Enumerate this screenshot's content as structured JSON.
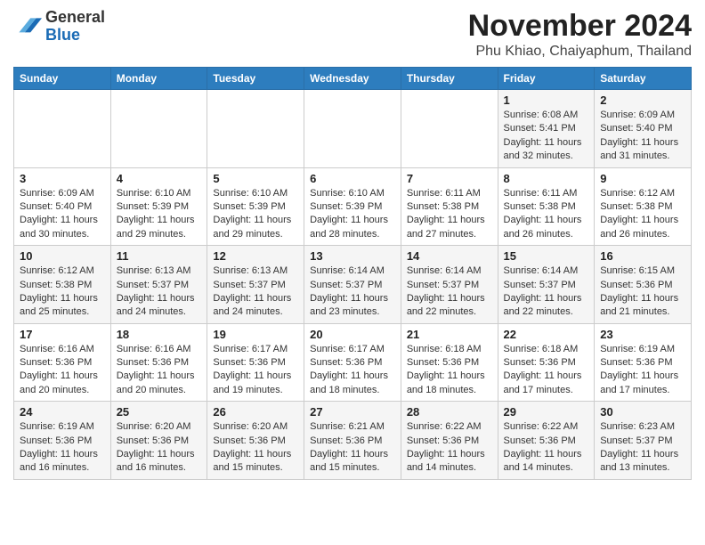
{
  "header": {
    "logo_line1": "General",
    "logo_line2": "Blue",
    "month_title": "November 2024",
    "location": "Phu Khiao, Chaiyaphum, Thailand"
  },
  "days_of_week": [
    "Sunday",
    "Monday",
    "Tuesday",
    "Wednesday",
    "Thursday",
    "Friday",
    "Saturday"
  ],
  "weeks": [
    {
      "days": [
        {
          "num": "",
          "info": ""
        },
        {
          "num": "",
          "info": ""
        },
        {
          "num": "",
          "info": ""
        },
        {
          "num": "",
          "info": ""
        },
        {
          "num": "",
          "info": ""
        },
        {
          "num": "1",
          "info": "Sunrise: 6:08 AM\nSunset: 5:41 PM\nDaylight: 11 hours\nand 32 minutes."
        },
        {
          "num": "2",
          "info": "Sunrise: 6:09 AM\nSunset: 5:40 PM\nDaylight: 11 hours\nand 31 minutes."
        }
      ]
    },
    {
      "days": [
        {
          "num": "3",
          "info": "Sunrise: 6:09 AM\nSunset: 5:40 PM\nDaylight: 11 hours\nand 30 minutes."
        },
        {
          "num": "4",
          "info": "Sunrise: 6:10 AM\nSunset: 5:39 PM\nDaylight: 11 hours\nand 29 minutes."
        },
        {
          "num": "5",
          "info": "Sunrise: 6:10 AM\nSunset: 5:39 PM\nDaylight: 11 hours\nand 29 minutes."
        },
        {
          "num": "6",
          "info": "Sunrise: 6:10 AM\nSunset: 5:39 PM\nDaylight: 11 hours\nand 28 minutes."
        },
        {
          "num": "7",
          "info": "Sunrise: 6:11 AM\nSunset: 5:38 PM\nDaylight: 11 hours\nand 27 minutes."
        },
        {
          "num": "8",
          "info": "Sunrise: 6:11 AM\nSunset: 5:38 PM\nDaylight: 11 hours\nand 26 minutes."
        },
        {
          "num": "9",
          "info": "Sunrise: 6:12 AM\nSunset: 5:38 PM\nDaylight: 11 hours\nand 26 minutes."
        }
      ]
    },
    {
      "days": [
        {
          "num": "10",
          "info": "Sunrise: 6:12 AM\nSunset: 5:38 PM\nDaylight: 11 hours\nand 25 minutes."
        },
        {
          "num": "11",
          "info": "Sunrise: 6:13 AM\nSunset: 5:37 PM\nDaylight: 11 hours\nand 24 minutes."
        },
        {
          "num": "12",
          "info": "Sunrise: 6:13 AM\nSunset: 5:37 PM\nDaylight: 11 hours\nand 24 minutes."
        },
        {
          "num": "13",
          "info": "Sunrise: 6:14 AM\nSunset: 5:37 PM\nDaylight: 11 hours\nand 23 minutes."
        },
        {
          "num": "14",
          "info": "Sunrise: 6:14 AM\nSunset: 5:37 PM\nDaylight: 11 hours\nand 22 minutes."
        },
        {
          "num": "15",
          "info": "Sunrise: 6:14 AM\nSunset: 5:37 PM\nDaylight: 11 hours\nand 22 minutes."
        },
        {
          "num": "16",
          "info": "Sunrise: 6:15 AM\nSunset: 5:36 PM\nDaylight: 11 hours\nand 21 minutes."
        }
      ]
    },
    {
      "days": [
        {
          "num": "17",
          "info": "Sunrise: 6:16 AM\nSunset: 5:36 PM\nDaylight: 11 hours\nand 20 minutes."
        },
        {
          "num": "18",
          "info": "Sunrise: 6:16 AM\nSunset: 5:36 PM\nDaylight: 11 hours\nand 20 minutes."
        },
        {
          "num": "19",
          "info": "Sunrise: 6:17 AM\nSunset: 5:36 PM\nDaylight: 11 hours\nand 19 minutes."
        },
        {
          "num": "20",
          "info": "Sunrise: 6:17 AM\nSunset: 5:36 PM\nDaylight: 11 hours\nand 18 minutes."
        },
        {
          "num": "21",
          "info": "Sunrise: 6:18 AM\nSunset: 5:36 PM\nDaylight: 11 hours\nand 18 minutes."
        },
        {
          "num": "22",
          "info": "Sunrise: 6:18 AM\nSunset: 5:36 PM\nDaylight: 11 hours\nand 17 minutes."
        },
        {
          "num": "23",
          "info": "Sunrise: 6:19 AM\nSunset: 5:36 PM\nDaylight: 11 hours\nand 17 minutes."
        }
      ]
    },
    {
      "days": [
        {
          "num": "24",
          "info": "Sunrise: 6:19 AM\nSunset: 5:36 PM\nDaylight: 11 hours\nand 16 minutes."
        },
        {
          "num": "25",
          "info": "Sunrise: 6:20 AM\nSunset: 5:36 PM\nDaylight: 11 hours\nand 16 minutes."
        },
        {
          "num": "26",
          "info": "Sunrise: 6:20 AM\nSunset: 5:36 PM\nDaylight: 11 hours\nand 15 minutes."
        },
        {
          "num": "27",
          "info": "Sunrise: 6:21 AM\nSunset: 5:36 PM\nDaylight: 11 hours\nand 15 minutes."
        },
        {
          "num": "28",
          "info": "Sunrise: 6:22 AM\nSunset: 5:36 PM\nDaylight: 11 hours\nand 14 minutes."
        },
        {
          "num": "29",
          "info": "Sunrise: 6:22 AM\nSunset: 5:36 PM\nDaylight: 11 hours\nand 14 minutes."
        },
        {
          "num": "30",
          "info": "Sunrise: 6:23 AM\nSunset: 5:37 PM\nDaylight: 11 hours\nand 13 minutes."
        }
      ]
    }
  ]
}
